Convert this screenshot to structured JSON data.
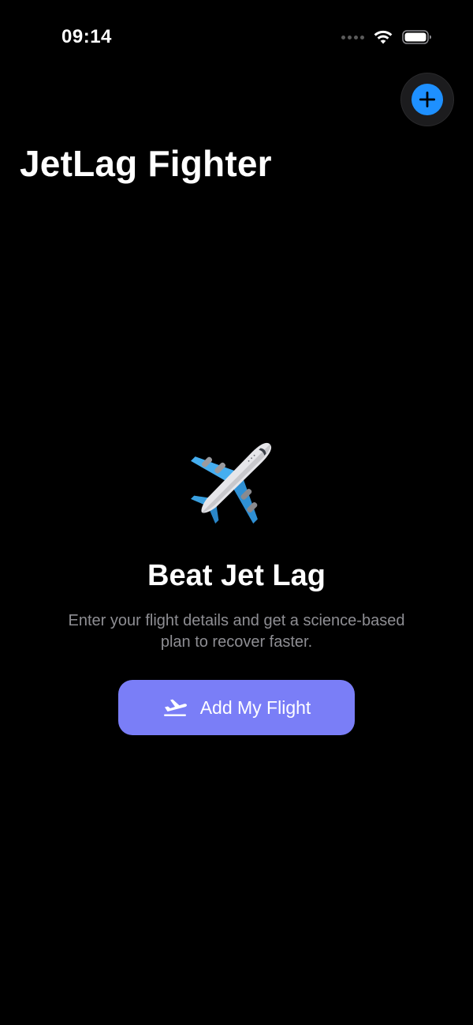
{
  "status_bar": {
    "time": "09:14",
    "icons": [
      "signal-dots-icon",
      "wifi-icon",
      "battery-icon"
    ]
  },
  "header": {
    "title": "JetLag Fighter",
    "add_button_icon": "plus-icon"
  },
  "empty_state": {
    "icon": "airplane-icon",
    "title": "Beat Jet Lag",
    "description": "Enter your flight details and get a science-based plan to recover faster.",
    "button_label": "Add My Flight",
    "button_icon": "airplane-departure-icon"
  },
  "colors": {
    "background": "#000000",
    "accent_blue": "#1e90ff",
    "button_purple": "#7a7ef7",
    "secondary_text": "#8e8e93"
  }
}
